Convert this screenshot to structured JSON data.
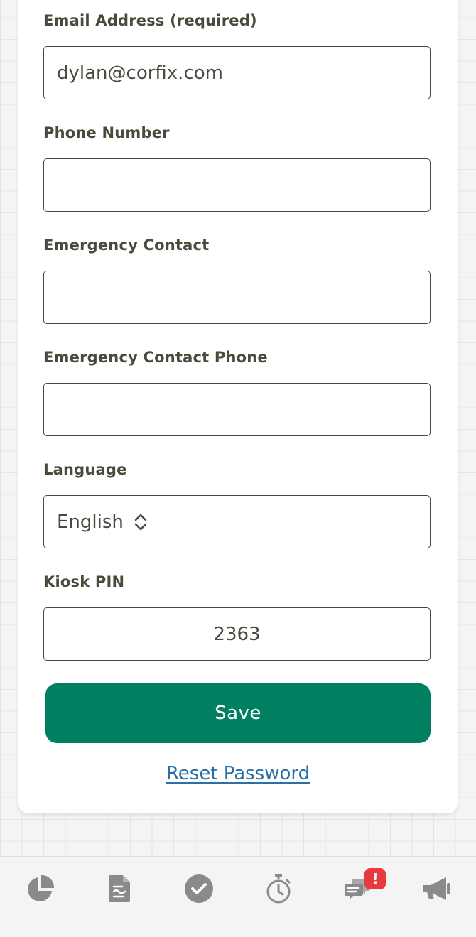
{
  "form": {
    "email": {
      "label": "Email Address (required)",
      "value": "dylan@corfix.com"
    },
    "phone": {
      "label": "Phone Number",
      "value": ""
    },
    "emergency_contact": {
      "label": "Emergency Contact",
      "value": ""
    },
    "emergency_contact_phone": {
      "label": "Emergency Contact Phone",
      "value": ""
    },
    "language": {
      "label": "Language",
      "value": "English"
    },
    "kiosk_pin": {
      "label": "Kiosk PIN",
      "value": "2363"
    },
    "save_label": "Save",
    "reset_password_label": "Reset Password"
  },
  "tabbar": {
    "items": [
      {
        "icon": "pie-chart-icon"
      },
      {
        "icon": "document-icon"
      },
      {
        "icon": "check-circle-icon"
      },
      {
        "icon": "stopwatch-icon"
      },
      {
        "icon": "chat-icon",
        "badge": "!"
      },
      {
        "icon": "megaphone-icon"
      }
    ]
  },
  "colors": {
    "accent": "#008060",
    "link": "#2b6fa8",
    "badge": "#e8393f",
    "icon": "#8a8a8a"
  }
}
